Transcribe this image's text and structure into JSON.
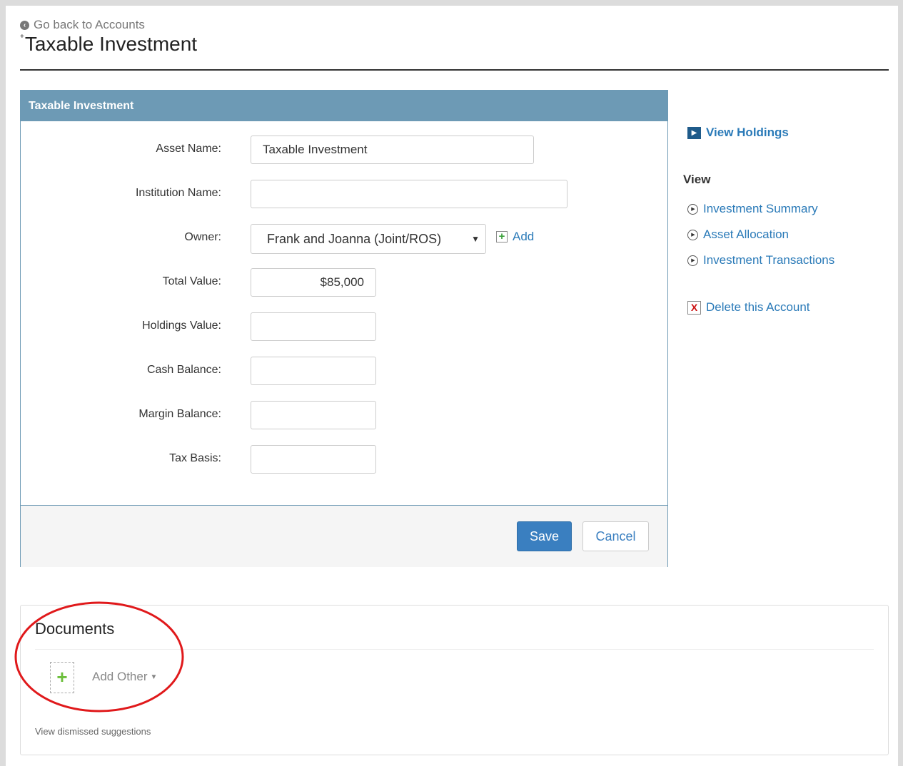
{
  "header": {
    "back_link": "Go back to Accounts",
    "title": "Taxable Investment",
    "title_marker": "+"
  },
  "panel": {
    "heading": "Taxable Investment",
    "fields": {
      "asset_name": {
        "label": "Asset Name:",
        "value": "Taxable Investment"
      },
      "institution_name": {
        "label": "Institution Name:",
        "value": ""
      },
      "owner": {
        "label": "Owner:",
        "value": "Frank and Joanna (Joint/ROS)",
        "add_label": "Add"
      },
      "total_value": {
        "label": "Total Value:",
        "value": "$85,000"
      },
      "holdings_value": {
        "label": "Holdings Value:",
        "value": ""
      },
      "cash_balance": {
        "label": "Cash Balance:",
        "value": ""
      },
      "margin_balance": {
        "label": "Margin Balance:",
        "value": ""
      },
      "tax_basis": {
        "label": "Tax Basis:",
        "value": ""
      }
    },
    "save_label": "Save",
    "cancel_label": "Cancel"
  },
  "sidebar": {
    "view_holdings": "View Holdings",
    "view_heading": "View",
    "links": {
      "investment_summary": "Investment Summary",
      "asset_allocation": "Asset Allocation",
      "investment_transactions": "Investment Transactions"
    },
    "delete_account": "Delete this Account"
  },
  "documents": {
    "title": "Documents",
    "add_other": "Add Other",
    "dismissed_link": "View dismissed suggestions"
  },
  "colors": {
    "panel_header": "#6d9ab5",
    "link": "#2a7ab8",
    "primary_button": "#3a7fc0",
    "annotation": "#e0191b"
  }
}
